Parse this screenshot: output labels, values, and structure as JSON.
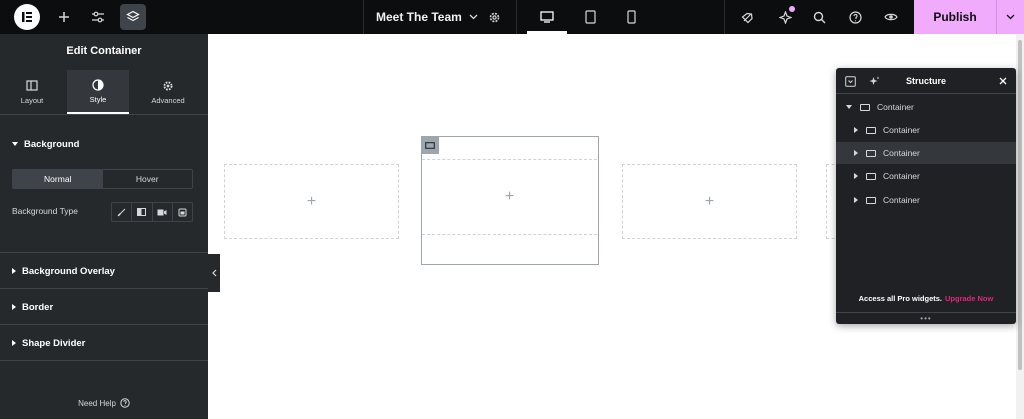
{
  "topbar": {
    "page_title": "Meet The Team",
    "publish_label": "Publish",
    "icons": {
      "logo": "elementor-logo",
      "add": "plus-icon",
      "settings": "sliders-icon",
      "structure": "layers-icon",
      "page_settings": "gear-icon",
      "desktop": "desktop-icon",
      "tablet": "tablet-icon",
      "mobile": "mobile-icon",
      "connect": "rocket-icon",
      "notifications": "sparkle-icon",
      "search": "search-icon",
      "help": "help-icon",
      "preview": "eye-icon",
      "publish_options": "chevron-down-icon"
    }
  },
  "panel": {
    "title": "Edit Container",
    "tabs": [
      {
        "label": "Layout",
        "icon": "layout-icon"
      },
      {
        "label": "Style",
        "icon": "half-circle-icon"
      },
      {
        "label": "Advanced",
        "icon": "gear-icon"
      }
    ],
    "active_tab": "Style",
    "background": {
      "heading": "Background",
      "state_tabs": [
        "Normal",
        "Hover"
      ],
      "active_state": "Normal",
      "type_label": "Background Type",
      "type_options": [
        "brush-icon",
        "gradient-icon",
        "video-icon",
        "slideshow-icon"
      ]
    },
    "collapsed_sections": [
      "Background Overlay",
      "Border",
      "Shape Divider"
    ],
    "need_help": "Need Help"
  },
  "canvas": {
    "add_symbol": "+"
  },
  "structure": {
    "title": "Structure",
    "root": "Container",
    "children": [
      "Container",
      "Container",
      "Container",
      "Container"
    ],
    "highlighted_index": 1,
    "footer_text": "Access all Pro widgets.",
    "footer_link": "Upgrade Now"
  },
  "colors": {
    "topbar_bg": "#0c0d0e",
    "panel_bg": "#26292c",
    "publish_accent": "#f0abfc",
    "upgrade_link": "#e1267c"
  }
}
